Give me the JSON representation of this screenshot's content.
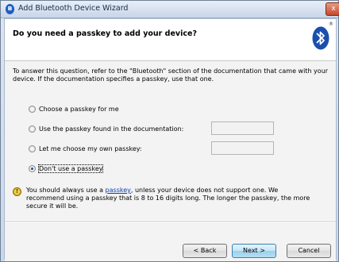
{
  "window": {
    "title": "Add Bluetooth Device Wizard",
    "close_glyph": "x"
  },
  "header": {
    "title": "Do you need a passkey to add your device?",
    "logo_icon": "bluetooth-icon",
    "logo_mark": "®"
  },
  "intro": "To answer this question, refer to the \"Bluetooth\" section of the documentation that came with your device. If the documentation specifies a passkey, use that one.",
  "options": [
    {
      "label": "Choose a passkey for me",
      "checked": false
    },
    {
      "label": "Use the passkey found in the documentation:",
      "checked": false
    },
    {
      "label": "Let me choose my own passkey:",
      "checked": false
    },
    {
      "label": "Don't use a passkey",
      "checked": true
    }
  ],
  "info": {
    "icon": "shield-warning-icon",
    "text_before": "You should always use a ",
    "link": "passkey",
    "text_after": ", unless your device does not support one. We recommend using a passkey that is 8 to 16 digits long. The longer the passkey, the more secure it will be."
  },
  "buttons": {
    "back": "< Back",
    "next": "Next >",
    "cancel": "Cancel"
  }
}
